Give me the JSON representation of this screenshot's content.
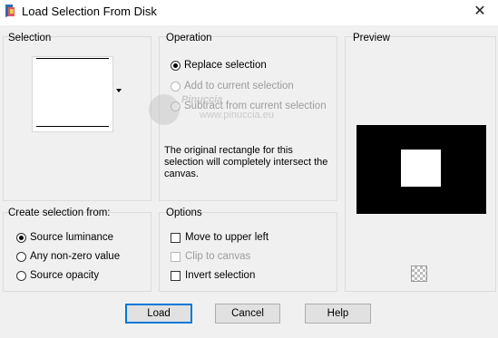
{
  "window": {
    "title": "Load Selection From Disk",
    "close_glyph": "✕"
  },
  "selection": {
    "group_label": "Selection"
  },
  "operation": {
    "group_label": "Operation",
    "options": [
      {
        "label": "Replace selection",
        "selected": true,
        "enabled": true
      },
      {
        "label": "Add to current selection",
        "selected": false,
        "enabled": false
      },
      {
        "label": "Subtract from current selection",
        "selected": false,
        "enabled": false
      }
    ],
    "description": "The original rectangle for this selection will completely intersect the canvas."
  },
  "preview": {
    "group_label": "Preview",
    "zoom_icon": "checkerboard-zoom-icon"
  },
  "create_from": {
    "group_label": "Create selection from:",
    "options": [
      {
        "label": "Source luminance",
        "selected": true
      },
      {
        "label": "Any non-zero value",
        "selected": false
      },
      {
        "label": "Source opacity",
        "selected": false
      }
    ]
  },
  "options": {
    "group_label": "Options",
    "items": [
      {
        "label": "Move to upper left",
        "checked": false,
        "enabled": true
      },
      {
        "label": "Clip to canvas",
        "checked": false,
        "enabled": false
      },
      {
        "label": "Invert selection",
        "checked": false,
        "enabled": true
      }
    ]
  },
  "buttons": {
    "load": "Load",
    "cancel": "Cancel",
    "help": "Help"
  },
  "watermark": {
    "name": "Pinuccia",
    "site": "www.pinuccia.eu"
  },
  "colors": {
    "default_button_border": "#0078d7",
    "dialog_background": "#f0f0f0"
  }
}
